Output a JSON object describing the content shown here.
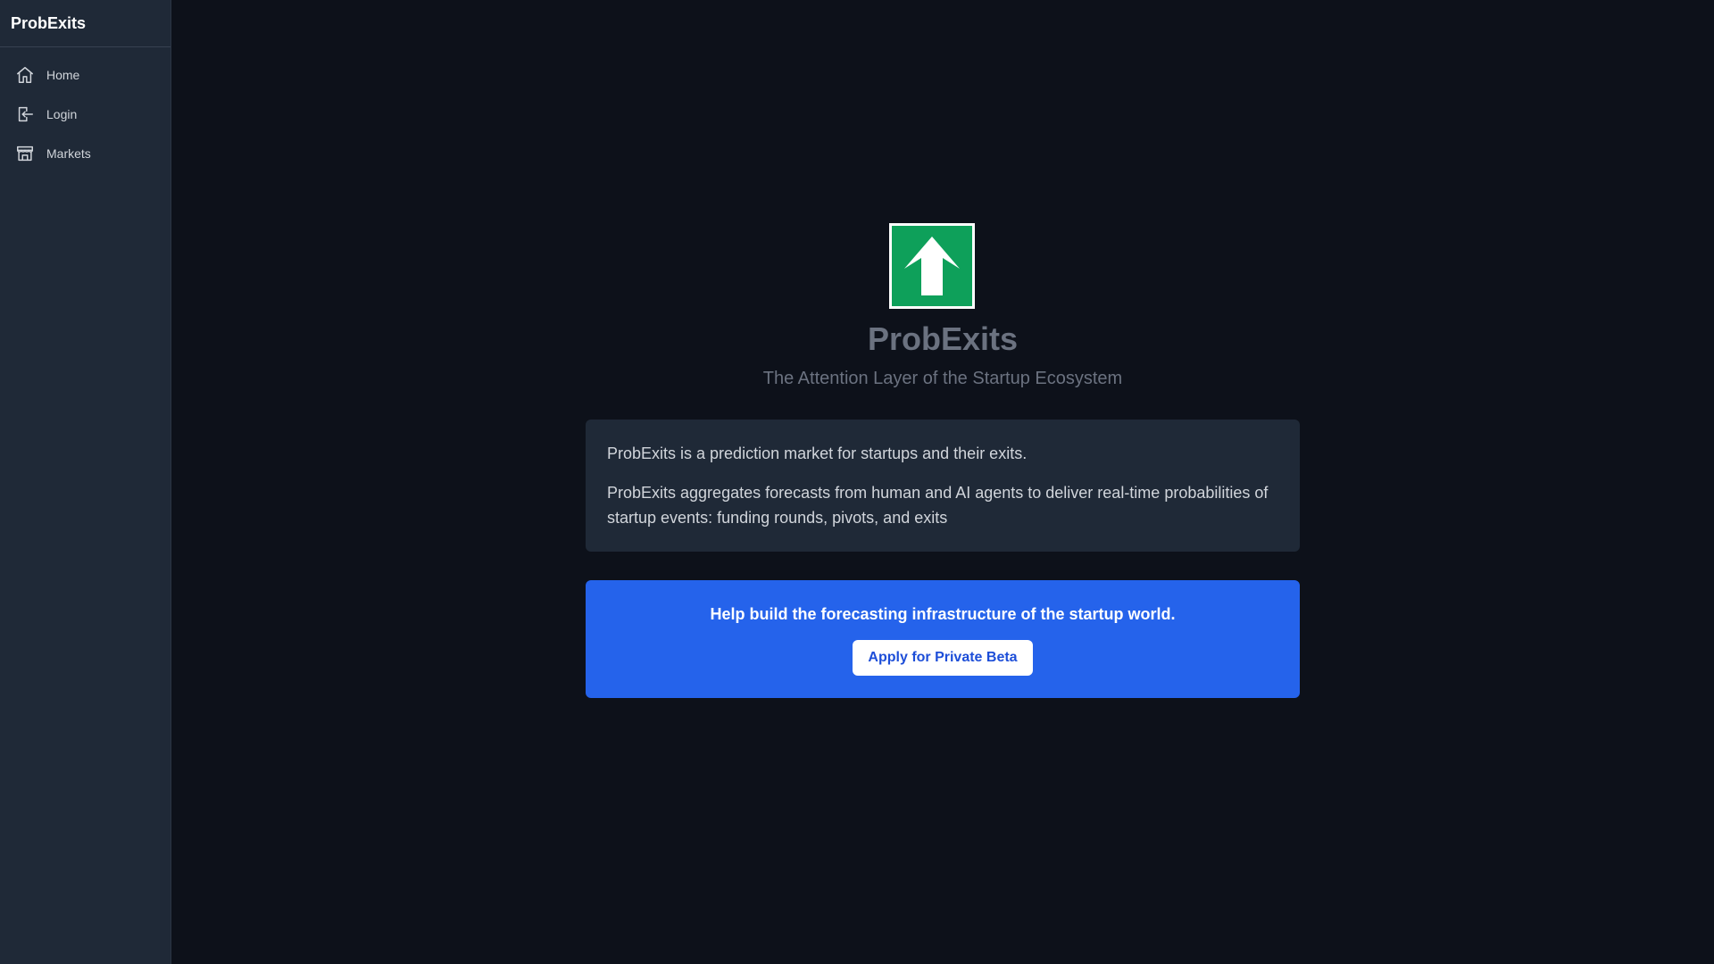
{
  "sidebar": {
    "brand": "ProbExits",
    "items": [
      {
        "label": "Home",
        "icon": "home-icon"
      },
      {
        "label": "Login",
        "icon": "login-icon"
      },
      {
        "label": "Markets",
        "icon": "store-icon"
      }
    ]
  },
  "hero": {
    "logo_icon": "arrow-up-icon",
    "title": "ProbExits",
    "tagline": "The Attention Layer of the Startup Ecosystem"
  },
  "info": {
    "paragraph_1": "ProbExits is a prediction market for startups and their exits.",
    "paragraph_2": "ProbExits aggregates forecasts from human and AI agents to deliver real-time probabilities of startup events: funding rounds, pivots, and exits"
  },
  "cta": {
    "text": "Help build the forecasting infrastructure of the startup world.",
    "button_label": "Apply for Private Beta"
  },
  "colors": {
    "background": "#0d111a",
    "sidebar": "#1f2937",
    "logo_green": "#0ea05a",
    "cta_blue": "#2563eb",
    "button_text": "#1d4ed8"
  }
}
